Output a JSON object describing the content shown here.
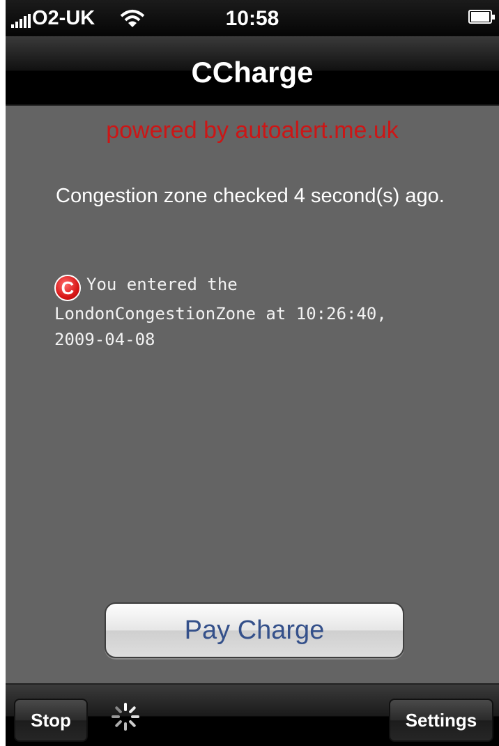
{
  "status_bar": {
    "carrier": "O2-UK",
    "time": "10:58"
  },
  "nav": {
    "title": "CCharge"
  },
  "content": {
    "powered_by": "powered by autoalert.me.uk",
    "checked_text": "Congestion zone checked 4 second(s) ago.",
    "entry_text": "You entered the LondonCongestionZone at 10:26:40, 2009-04-08",
    "entry_icon": "congestion-c-icon",
    "pay_button": "Pay Charge"
  },
  "toolbar": {
    "stop": "Stop",
    "settings": "Settings",
    "activity": "loading-spinner-icon"
  },
  "colors": {
    "background": "#646464",
    "powered_by": "#cc1616",
    "button_text": "#34508a"
  }
}
